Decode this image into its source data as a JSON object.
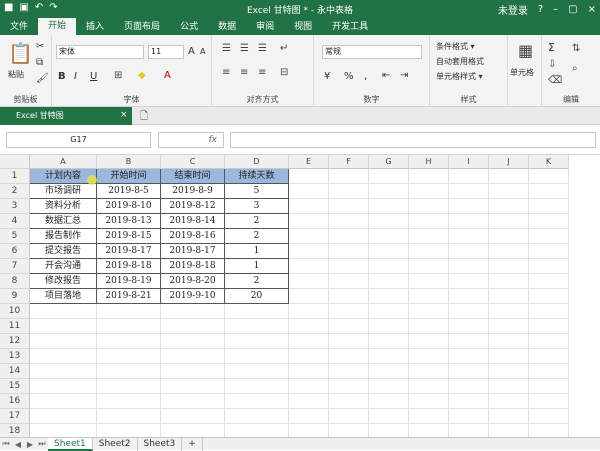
{
  "window": {
    "title": "Excel 甘特图 * - 永中表格",
    "user": "未登录",
    "help": "?",
    "minimize": "–",
    "restore": "▢",
    "close": "×"
  },
  "ribbon_tabs": [
    "文件",
    "开始",
    "插入",
    "页面布局",
    "公式",
    "数据",
    "审阅",
    "视图",
    "开发工具"
  ],
  "ribbon": {
    "paste_label": "粘贴",
    "clipboard_label": "剪贴板",
    "font_name": "宋体",
    "font_size": "11",
    "bold": "B",
    "italic": "I",
    "underline": "U",
    "grow_font": "A",
    "shrink_font": "A",
    "font_label": "字体",
    "align_label": "对齐方式",
    "number_format": "常规",
    "number_label": "数字",
    "conditional_format": "条件格式 ▾",
    "auto_table_format": "自动套用格式",
    "cell_style": "单元格样式 ▾",
    "style_label": "样式",
    "cells_btn": "单元格",
    "edit_label": "编辑",
    "sum_icon": "Σ",
    "currency": "¥",
    "percent": "%",
    "comma": ","
  },
  "doc_tab": "Excel 甘特图",
  "formula": {
    "name_box": "G17",
    "fx": "fx"
  },
  "columns": [
    "A",
    "B",
    "C",
    "D",
    "E",
    "F",
    "G",
    "H",
    "I",
    "J",
    "K"
  ],
  "rows": [
    "1",
    "2",
    "3",
    "4",
    "5",
    "6",
    "7",
    "8",
    "9",
    "10",
    "11",
    "12",
    "13",
    "14",
    "15",
    "16",
    "17",
    "18"
  ],
  "table": {
    "headers": [
      "计划内容",
      "开始时间",
      "结束时间",
      "持续天数"
    ],
    "data": [
      [
        "市场调研",
        "2019-8-5",
        "2019-8-9",
        "5"
      ],
      [
        "资料分析",
        "2019-8-10",
        "2019-8-12",
        "3"
      ],
      [
        "数据汇总",
        "2019-8-13",
        "2019-8-14",
        "2"
      ],
      [
        "报告制作",
        "2019-8-15",
        "2019-8-16",
        "2"
      ],
      [
        "提交报告",
        "2019-8-17",
        "2019-8-17",
        "1"
      ],
      [
        "开会沟通",
        "2019-8-18",
        "2019-8-18",
        "1"
      ],
      [
        "修改报告",
        "2019-8-19",
        "2019-8-20",
        "2"
      ],
      [
        "项目落地",
        "2019-8-21",
        "2019-9-10",
        "20"
      ]
    ]
  },
  "sheets": [
    "Sheet1",
    "Sheet2",
    "Sheet3"
  ],
  "sheet_add": "+",
  "colors": {
    "brand": "#217346",
    "header_fill": "#9bb7dc"
  }
}
